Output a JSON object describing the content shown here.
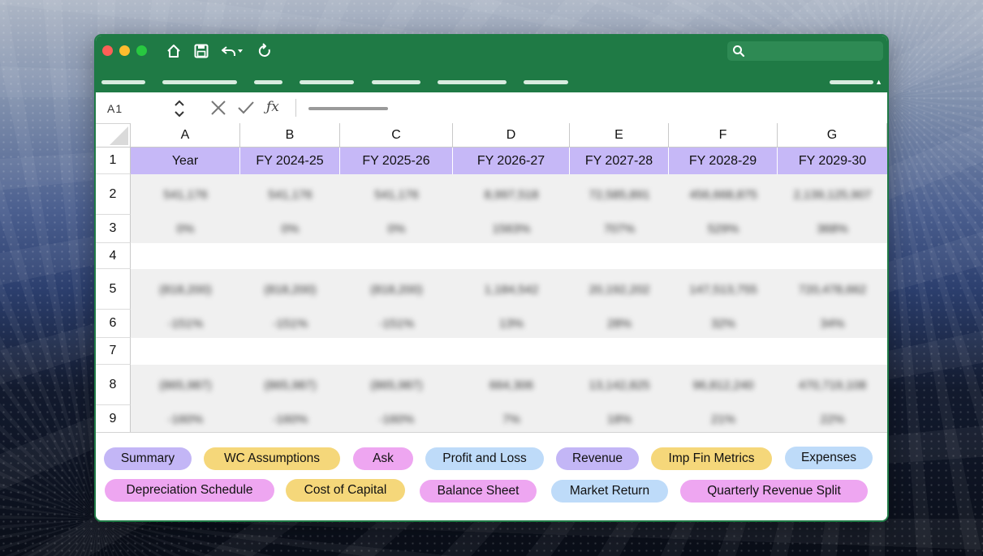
{
  "app": {
    "name_box": "A1",
    "formula_icon": "ƒx",
    "window_controls": [
      "close",
      "minimize",
      "zoom"
    ],
    "toolbar_icons": [
      "home-icon",
      "save-icon",
      "undo-icon",
      "undo-dropdown-icon",
      "refresh-icon"
    ],
    "search_icon": "search-icon"
  },
  "sheet": {
    "column_headers": [
      "A",
      "B",
      "C",
      "D",
      "E",
      "F",
      "G"
    ],
    "row_numbers": [
      "1",
      "2",
      "3",
      "4",
      "5",
      "6",
      "7",
      "8",
      "9"
    ],
    "header_row": [
      "Year",
      "FY 2024-25",
      "FY 2025-26",
      "FY 2026-27",
      "FY 2027-28",
      "FY 2028-29",
      "FY 2029-30"
    ],
    "blurred_rows": [
      [
        "541,176",
        "541,176",
        "8,997,518",
        "72,585,891",
        "456,668,875",
        "2,139,125,907"
      ],
      [
        "0%",
        "0%",
        "1563%",
        "707%",
        "529%",
        "368%"
      ],
      [],
      [
        "(818,200)",
        "(818,200)",
        "1,184,542",
        "20,192,202",
        "147,513,755",
        "720,478,662"
      ],
      [
        "-151%",
        "-151%",
        "13%",
        "28%",
        "32%",
        "34%"
      ],
      [],
      [
        "(865,987)",
        "(865,987)",
        "664,306",
        "13,142,825",
        "96,812,240",
        "470,719,108"
      ],
      [
        "-160%",
        "-160%",
        "7%",
        "18%",
        "21%",
        "22%"
      ]
    ]
  },
  "tabs": [
    {
      "label": "Summary",
      "color": "#c3b6f6"
    },
    {
      "label": "WC Assumptions",
      "color": "#f5d77a"
    },
    {
      "label": "Ask",
      "color": "#eea6f1"
    },
    {
      "label": "Profit and Loss",
      "color": "#bedbf9"
    },
    {
      "label": "Revenue",
      "color": "#c3b6f6"
    },
    {
      "label": "Imp Fin Metrics",
      "color": "#f5d77a"
    },
    {
      "label": "Expenses",
      "color": "#bedbf9"
    },
    {
      "label": "Depreciation Schedule",
      "color": "#eea6f1"
    },
    {
      "label": "Cost of Capital",
      "color": "#f5d77a"
    },
    {
      "label": "Balance Sheet",
      "color": "#eea6f1"
    },
    {
      "label": "Market Return",
      "color": "#bedbf9"
    },
    {
      "label": "Quarterly Revenue Split",
      "color": "#eea6f1"
    }
  ],
  "colors": {
    "titlebar": "#1f7a45",
    "header_row": "#c6b8f7"
  }
}
